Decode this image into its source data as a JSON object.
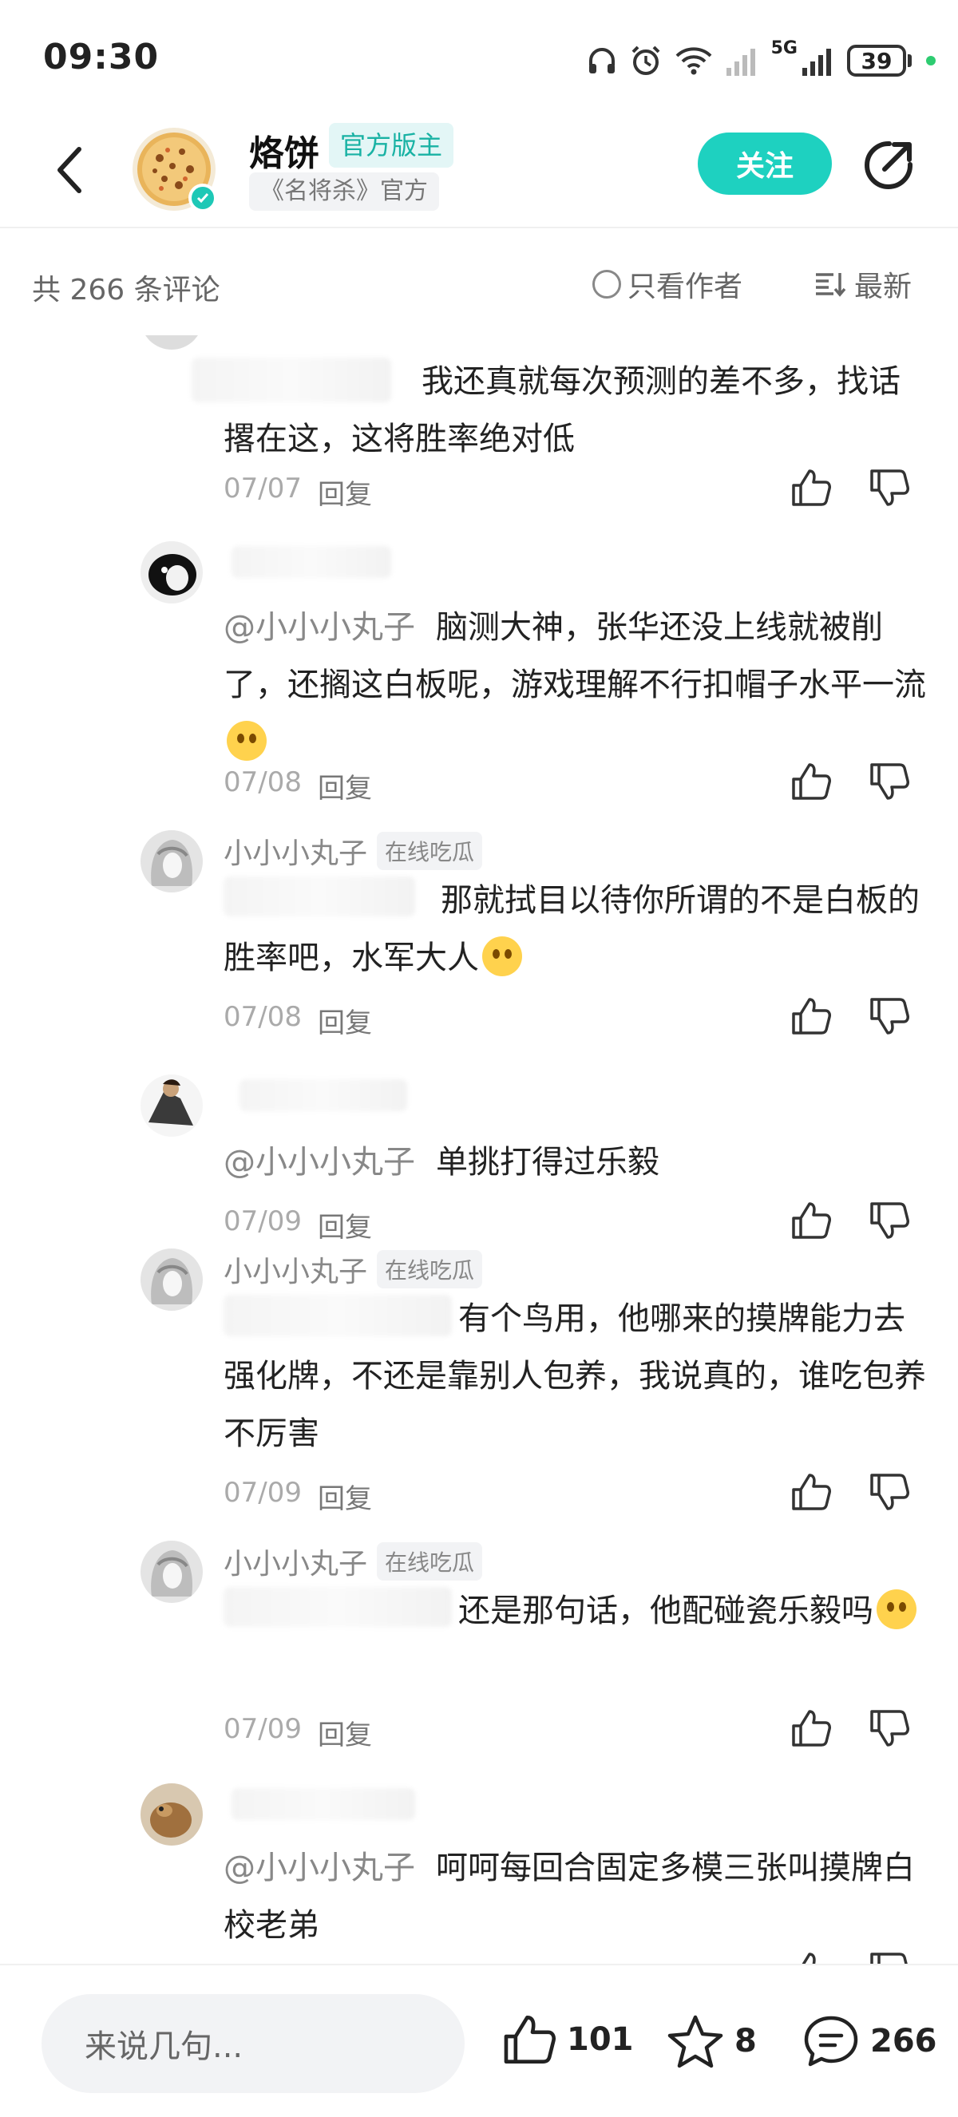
{
  "status_bar": {
    "time": "09:30",
    "battery": "39",
    "network": "5G",
    "icons": [
      "headphones-icon",
      "alarm-icon",
      "wifi-icon",
      "signal-icon",
      "battery-icon"
    ]
  },
  "header": {
    "name": "烙饼",
    "badge": "官方版主",
    "subtitle": "《名将杀》官方",
    "follow_label": "关注",
    "back_icon": "back-arrow-icon",
    "share_icon": "share-icon"
  },
  "filter": {
    "count_label": "共 266 条评论",
    "author_only_label": "只看作者",
    "sort_label": "最新"
  },
  "replies": [
    {
      "name": "",
      "tag": "",
      "mention": "",
      "text": "我还真就每次预测的差不多，找话撂在这，这将胜率绝对低",
      "date": "07/07",
      "reply_label": "回复"
    },
    {
      "name": "",
      "tag": "",
      "mention": "@小小小丸子",
      "text": "脑测大神，张华还没上线就被削了，还搁这白板呢，游戏理解不行扣帽子水平一流",
      "date": "07/08",
      "reply_label": "回复"
    },
    {
      "name": "小小小丸子",
      "tag": "在线吃瓜",
      "mention": "",
      "text": "那就拭目以待你所谓的不是白板的胜率吧，水军大人",
      "date": "07/08",
      "reply_label": "回复"
    },
    {
      "name": "",
      "tag": "",
      "mention": "@小小小丸子",
      "text": "单挑打得过乐毅",
      "date": "07/09",
      "reply_label": "回复"
    },
    {
      "name": "小小小丸子",
      "tag": "在线吃瓜",
      "mention": "",
      "text": "有个鸟用，他哪来的摸牌能力去强化牌，不还是靠别人包养，我说真的，谁吃包养不厉害",
      "date": "07/09",
      "reply_label": "回复"
    },
    {
      "name": "小小小丸子",
      "tag": "在线吃瓜",
      "mention": "",
      "text": "还是那句话，他配碰瓷乐毅吗",
      "date": "07/09",
      "reply_label": "回复"
    },
    {
      "name": "",
      "tag": "",
      "mention": "@小小小丸子",
      "text": "呵呵每回合固定多模三张叫摸牌白校老弟",
      "date": "",
      "reply_label": ""
    }
  ],
  "bottom_bar": {
    "input_placeholder": "来说几句...",
    "likes": "101",
    "stars": "8",
    "comments": "266"
  }
}
